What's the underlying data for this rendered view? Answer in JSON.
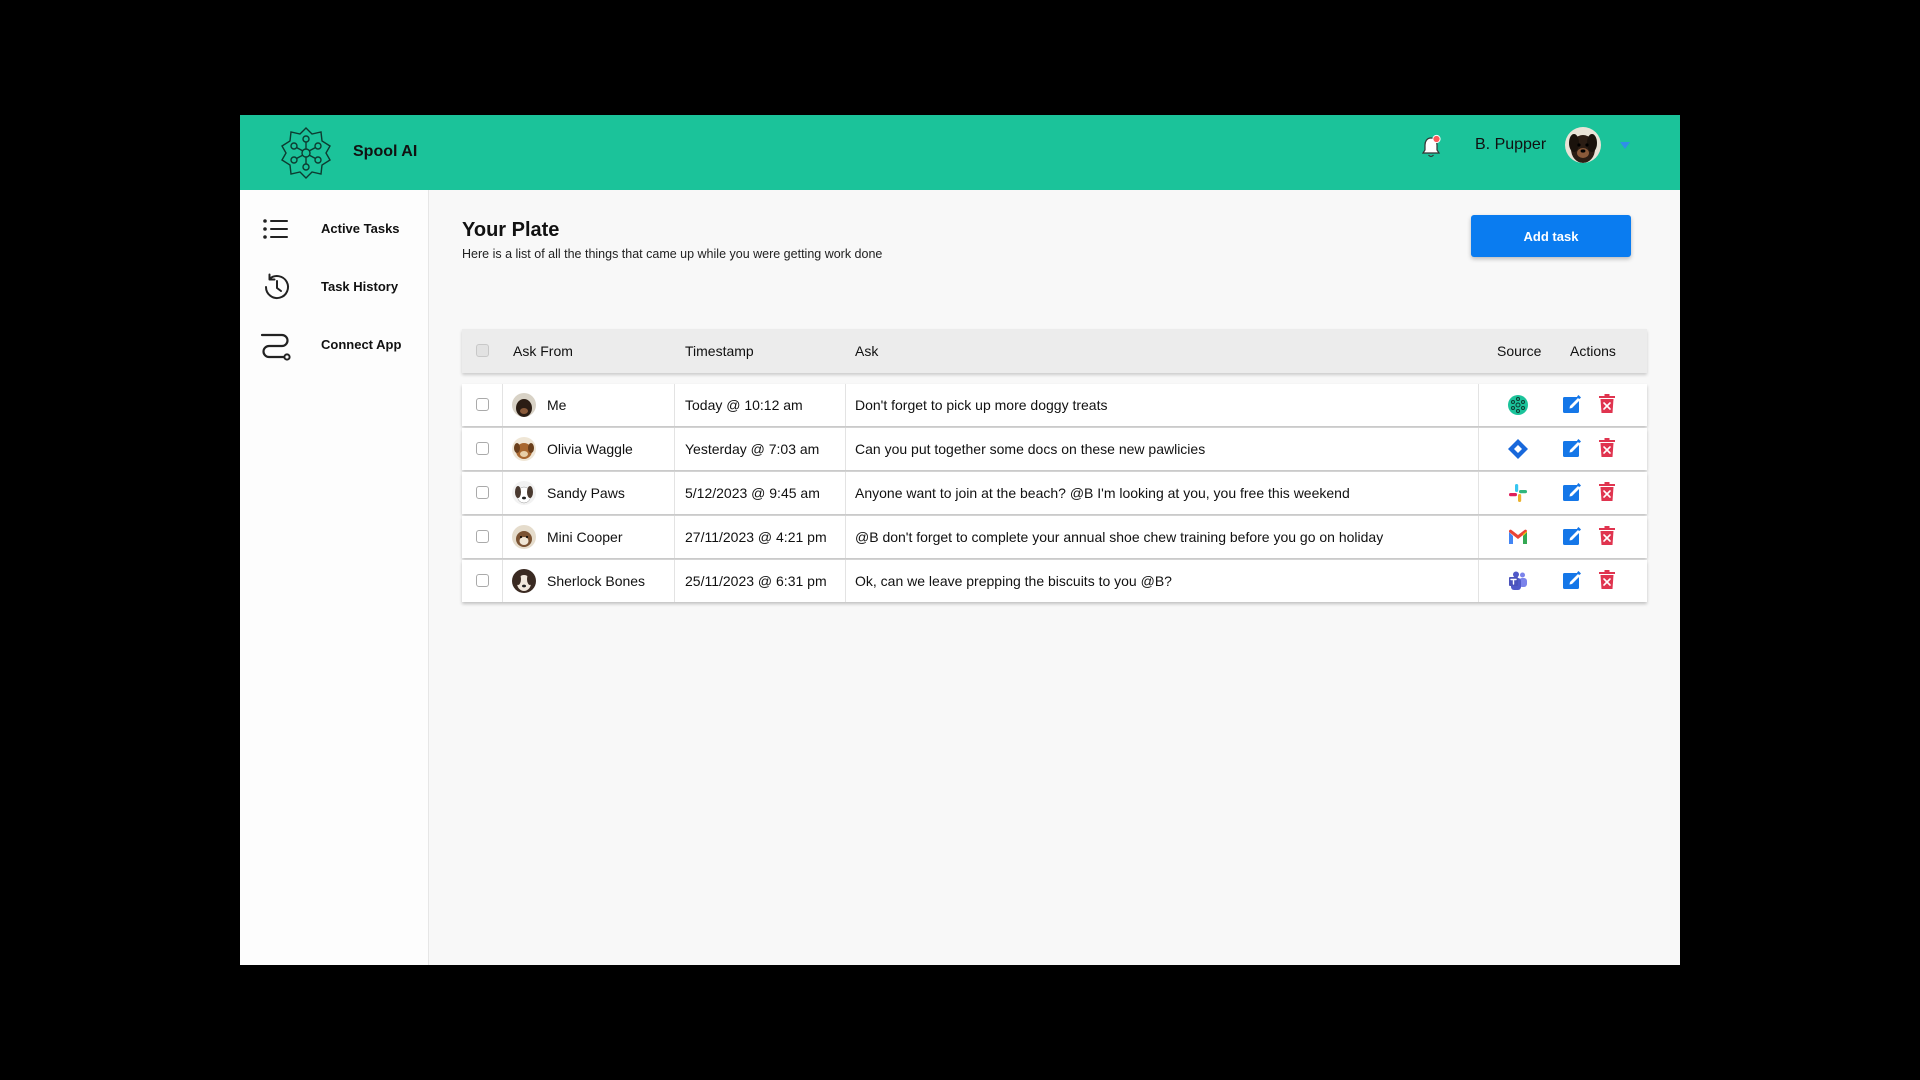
{
  "app": {
    "name": "Spool AI",
    "brand_color": "#1bc39a",
    "accent_color": "#0a7cf0",
    "delete_color": "#e0344f"
  },
  "user": {
    "name": "B. Pupper"
  },
  "sidebar": {
    "items": [
      {
        "label": "Active Tasks",
        "icon": "list-icon"
      },
      {
        "label": "Task History",
        "icon": "history-icon"
      },
      {
        "label": "Connect App",
        "icon": "connect-route-icon"
      }
    ]
  },
  "main": {
    "title": "Your Plate",
    "subtitle": "Here is a list of all the things that came up while you were getting work done",
    "add_button": "Add task"
  },
  "table": {
    "headers": {
      "ask_from": "Ask From",
      "timestamp": "Timestamp",
      "ask": "Ask",
      "source": "Source",
      "actions": "Actions"
    },
    "rows": [
      {
        "ask_from": "Me",
        "timestamp": "Today @ 10:12 am",
        "ask": "Don't forget to pick up more doggy treats",
        "source": "spool-ai"
      },
      {
        "ask_from": "Olivia Waggle",
        "timestamp": "Yesterday @ 7:03 am",
        "ask": "Can you put together some docs on these new pawlicies",
        "source": "jira"
      },
      {
        "ask_from": "Sandy Paws",
        "timestamp": "5/12/2023 @ 9:45 am",
        "ask": "Anyone want to join at the beach? @B I'm looking at you, you free this weekend",
        "source": "slack"
      },
      {
        "ask_from": "Mini Cooper",
        "timestamp": "27/11/2023 @ 4:21 pm",
        "ask": "@B don't forget to complete your annual shoe chew training before you go on holiday",
        "source": "gmail"
      },
      {
        "ask_from": "Sherlock Bones",
        "timestamp": "25/11/2023 @ 6:31 pm",
        "ask": "Ok, can we leave prepping the biscuits to you @B?",
        "source": "teams"
      }
    ]
  }
}
